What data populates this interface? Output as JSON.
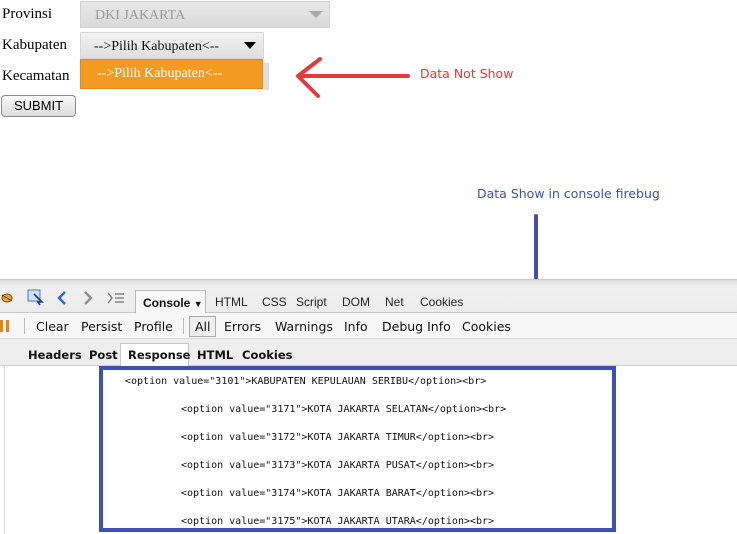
{
  "form": {
    "provinsi_label": "Provinsi",
    "provinsi_value": "DKI JAKARTA",
    "kabupaten_label": "Kabupaten",
    "kabupaten_value": "-->Pilih Kabupaten<--",
    "kecamatan_label": "Kecamatan",
    "dropdown_option": "-->Pilih Kabupaten<--",
    "submit_label": "SUBMIT"
  },
  "annotations": {
    "red_note": "Data Not Show",
    "blue_note": "Data Show in console firebug",
    "red_color": "#e43a3a",
    "blue_color": "#3f50b5"
  },
  "firebug": {
    "top_tabs": [
      "Console",
      "HTML",
      "CSS",
      "Script",
      "DOM",
      "Net",
      "Cookies"
    ],
    "toolbar": [
      "Clear",
      "Persist",
      "Profile",
      "All",
      "Errors",
      "Warnings",
      "Info",
      "Debug Info",
      "Cookies"
    ],
    "subtabs": [
      "Headers",
      "Post",
      "Response",
      "HTML",
      "Cookies"
    ],
    "active_subtab": "Response",
    "response_lines": [
      "<option value=\"3101\">KABUPATEN KEPULAUAN SERIBU</option><br>",
      "<option value=\"3171\">KOTA JAKARTA SELATAN</option><br>",
      "<option value=\"3172\">KOTA JAKARTA TIMUR</option><br>",
      "<option value=\"3173\">KOTA JAKARTA PUSAT</option><br>",
      "<option value=\"3174\">KOTA JAKARTA BARAT</option><br>",
      "<option value=\"3175\">KOTA JAKARTA UTARA</option><br>"
    ],
    "icons": [
      "firebug-bug-icon",
      "inspect-icon",
      "back-arrow-icon",
      "forward-arrow-icon",
      "command-line-icon"
    ]
  }
}
